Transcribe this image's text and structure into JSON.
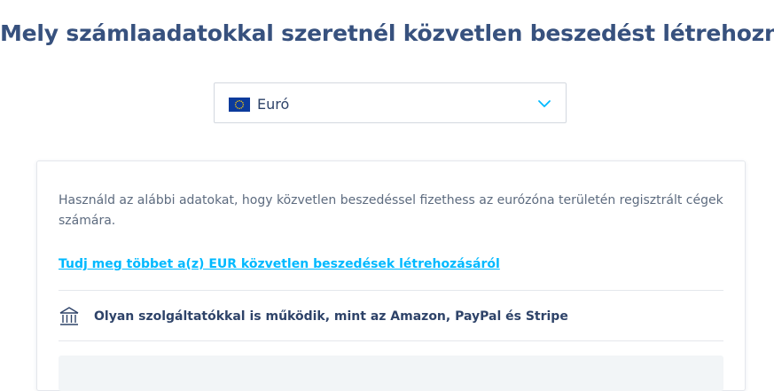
{
  "page": {
    "title": "Mely számlaadatokkal szeretnél közvetlen beszedést létrehozni?"
  },
  "currency_select": {
    "selected": "Euró",
    "flag_icon": "eu-flag-icon",
    "chevron_icon": "chevron-down-icon"
  },
  "card": {
    "description": "Használd az alábbi adatokat, hogy közvetlen beszedéssel fizethess az eurózóna területén regisztrált cégek számára.",
    "learn_more_link": "Tudj meg többet a(z) EUR közvetlen beszedések létrehozásáról",
    "feature": {
      "icon": "bank-icon",
      "text": "Olyan szolgáltatókkal is működik, mint az Amazon, PayPal és Stripe"
    }
  },
  "colors": {
    "title": "#37517e",
    "text": "#2e4369",
    "muted_text": "#5d6b7f",
    "link": "#00b9ff",
    "chevron": "#00b9ff",
    "flag_blue": "#0c3b9c",
    "flag_stars": "#ffcc00",
    "details_bg": "#f2f5f7"
  }
}
